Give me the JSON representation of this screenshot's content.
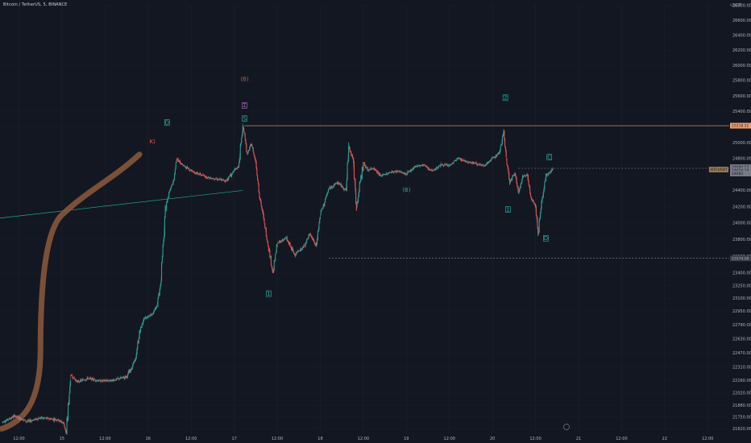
{
  "header": {
    "title": "Bitcoin / TetherUS, 5, BINANCE",
    "currency": "USDT"
  },
  "colors": {
    "background": "#131722",
    "candle_up": "#26a69a",
    "candle_down": "#ef5350",
    "trend_curve": "#8d5a3c",
    "label_teal": "#26a69a",
    "label_red": "#ef5350",
    "label_brown": "#a8684a",
    "resistance": "#f0a06a",
    "support_dash": "#8b8f99",
    "trendline": "#26a69a"
  },
  "chart_data": {
    "type": "line",
    "title": "Bitcoin / TetherUS, 5, BINANCE",
    "ylabel": "USDT",
    "ylim": [
      21570,
      26810
    ],
    "y_ticks": [
      26800,
      26600,
      26400,
      26200,
      26000,
      25800,
      25600,
      25400,
      25200,
      25000,
      24800,
      24600,
      24400,
      24200,
      24000,
      23800,
      23600,
      23400,
      23250,
      23100,
      22950,
      22790,
      22630,
      22470,
      22310,
      22160,
      22020,
      21880,
      21750,
      21620
    ],
    "x_ticks": [
      "12:00",
      "15",
      "12:00",
      "16",
      "12:00",
      "17",
      "12:00",
      "18",
      "12:00",
      "19",
      "12:00",
      "20",
      "12:00",
      "21",
      "12:00",
      "22",
      "12:00"
    ],
    "x_tick_days": [
      14.5,
      15,
      15.5,
      16,
      16.5,
      17,
      17.5,
      18,
      18.5,
      19,
      19.5,
      20,
      20.5,
      21,
      21.5,
      22,
      22.5
    ],
    "xlim": [
      14.28,
      22.75
    ],
    "series": [
      {
        "x": [
          14.3,
          14.45,
          14.6,
          14.75,
          14.95,
          15.02,
          15.05,
          15.1,
          15.18,
          15.3,
          15.45,
          15.6,
          15.75,
          15.85,
          15.9,
          15.95,
          16.05,
          16.1,
          16.15,
          16.2,
          16.25,
          16.3,
          16.33,
          16.42,
          16.55,
          16.7,
          16.9,
          17.05,
          17.1,
          17.12,
          17.15,
          17.2,
          17.25,
          17.3,
          17.35,
          17.4,
          17.45,
          17.5,
          17.6,
          17.7,
          17.8,
          17.88,
          17.95,
          18.0,
          18.1,
          18.2,
          18.3,
          18.33,
          18.38,
          18.42,
          18.5,
          18.55,
          18.62,
          18.7,
          18.8,
          18.9,
          19.0,
          19.1,
          19.2,
          19.3,
          19.4,
          19.5,
          19.6,
          19.7,
          19.8,
          19.9,
          19.98,
          20.08,
          20.13,
          20.16,
          20.2,
          20.26,
          20.3,
          20.35,
          20.4,
          20.45,
          20.5,
          20.53,
          20.57,
          20.62,
          20.7
        ],
        "y": [
          21690,
          21760,
          21700,
          21740,
          21720,
          21680,
          21560,
          22220,
          22140,
          22180,
          22150,
          22160,
          22200,
          22380,
          22700,
          22860,
          22920,
          23000,
          23300,
          24150,
          24400,
          24530,
          24790,
          24700,
          24620,
          24560,
          24520,
          24700,
          25200,
          25120,
          24850,
          24980,
          24760,
          24300,
          24000,
          23700,
          23400,
          23750,
          23820,
          23620,
          23700,
          23870,
          23720,
          24100,
          24420,
          24500,
          24400,
          24950,
          24800,
          24200,
          24750,
          24650,
          24680,
          24580,
          24620,
          24640,
          24600,
          24700,
          24720,
          24640,
          24720,
          24710,
          24800,
          24760,
          24740,
          24700,
          24780,
          24870,
          25150,
          24800,
          24500,
          24620,
          24360,
          24560,
          24600,
          24300,
          24200,
          23870,
          24250,
          24580,
          24670
        ]
      }
    ]
  },
  "annotations": {
    "wave_labels": [
      "(B)",
      "Σ",
      "S",
      "D",
      "K)",
      "1",
      "2",
      "D",
      "(B)",
      "C",
      "1"
    ],
    "price_labels": [
      "25218.52",
      "24680.57",
      "24654.24",
      "24682",
      "23574.00"
    ]
  }
}
